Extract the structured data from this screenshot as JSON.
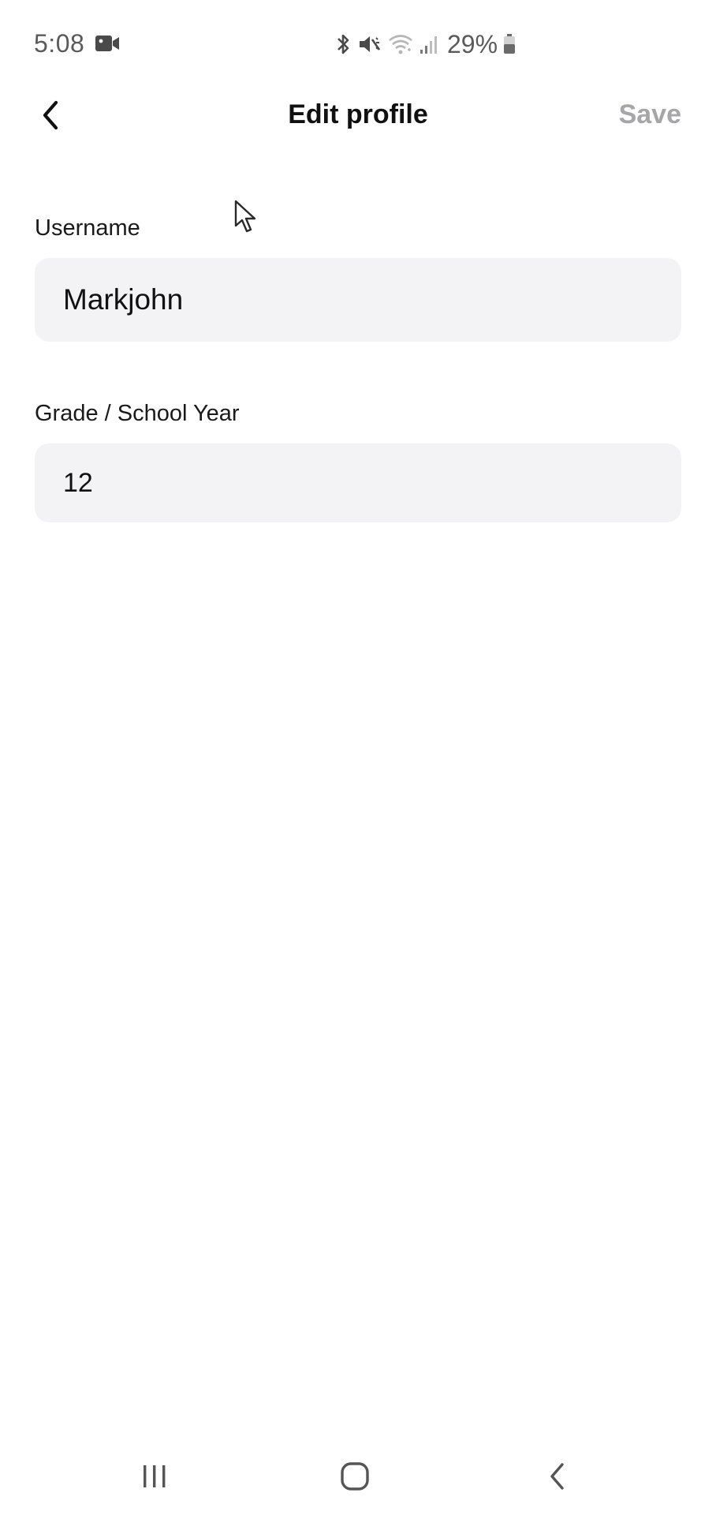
{
  "status_bar": {
    "time": "5:08",
    "battery_percent": "29%",
    "icons": [
      "video-camera-icon",
      "bluetooth-icon",
      "mute-icon",
      "wifi-icon",
      "signal-icon",
      "battery-icon"
    ]
  },
  "header": {
    "title": "Edit profile",
    "save_label": "Save",
    "back_icon": "chevron-left-icon"
  },
  "form": {
    "username": {
      "label": "Username",
      "value": "Markjohn"
    },
    "grade": {
      "label": "Grade / School Year",
      "value": "12"
    }
  },
  "nav_bar": {
    "icons": [
      "recents-icon",
      "home-icon",
      "back-icon"
    ]
  },
  "colors": {
    "background": "#ffffff",
    "input_background": "#f3f3f5",
    "save_disabled": "#a6a6aa",
    "text": "#111111",
    "status_text": "#5a5a5a"
  }
}
